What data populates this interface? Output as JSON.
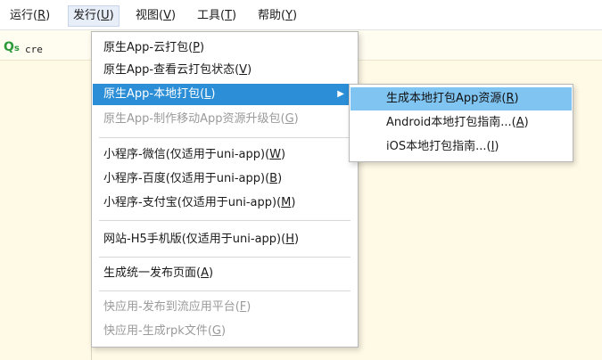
{
  "menubar": {
    "items": [
      {
        "label": "运行(",
        "key": "R",
        "suffix": ")"
      },
      {
        "label": "发行(",
        "key": "U",
        "suffix": ")"
      },
      {
        "label": "视图(",
        "key": "V",
        "suffix": ")"
      },
      {
        "label": "工具(",
        "key": "T",
        "suffix": ")"
      },
      {
        "label": "帮助(",
        "key": "Y",
        "suffix": ")"
      }
    ]
  },
  "toolbar": {
    "search_icon_main": "Q",
    "search_icon_sub": "s",
    "command_text": "cre"
  },
  "dropdown": {
    "items": [
      {
        "label": "原生App-云打包(",
        "key": "P",
        "suffix": ")"
      },
      {
        "label": "原生App-查看云打包状态(",
        "key": "V",
        "suffix": ")"
      },
      {
        "label": "原生App-本地打包(",
        "key": "L",
        "suffix": ")",
        "arrow": "▶"
      },
      {
        "label": "原生App-制作移动App资源升级包(",
        "key": "G",
        "suffix": ")"
      },
      {
        "label": "小程序-微信(仅适用于uni-app)(",
        "key": "W",
        "suffix": ")"
      },
      {
        "label": "小程序-百度(仅适用于uni-app)(",
        "key": "B",
        "suffix": ")"
      },
      {
        "label": "小程序-支付宝(仅适用于uni-app)(",
        "key": "M",
        "suffix": ")"
      },
      {
        "label": "网站-H5手机版(仅适用于uni-app)(",
        "key": "H",
        "suffix": ")"
      },
      {
        "label": "生成统一发布页面(",
        "key": "A",
        "suffix": ")"
      },
      {
        "label": "快应用-发布到流应用平台(",
        "key": "F",
        "suffix": ")"
      },
      {
        "label": "快应用-生成rpk文件(",
        "key": "G",
        "suffix": ")"
      }
    ]
  },
  "submenu": {
    "items": [
      {
        "label": "生成本地打包App资源(",
        "key": "R",
        "suffix": ")"
      },
      {
        "label": "Android本地打包指南...(",
        "key": "A",
        "suffix": ")"
      },
      {
        "label": "iOS本地打包指南...(",
        "key": "I",
        "suffix": ")"
      }
    ]
  }
}
